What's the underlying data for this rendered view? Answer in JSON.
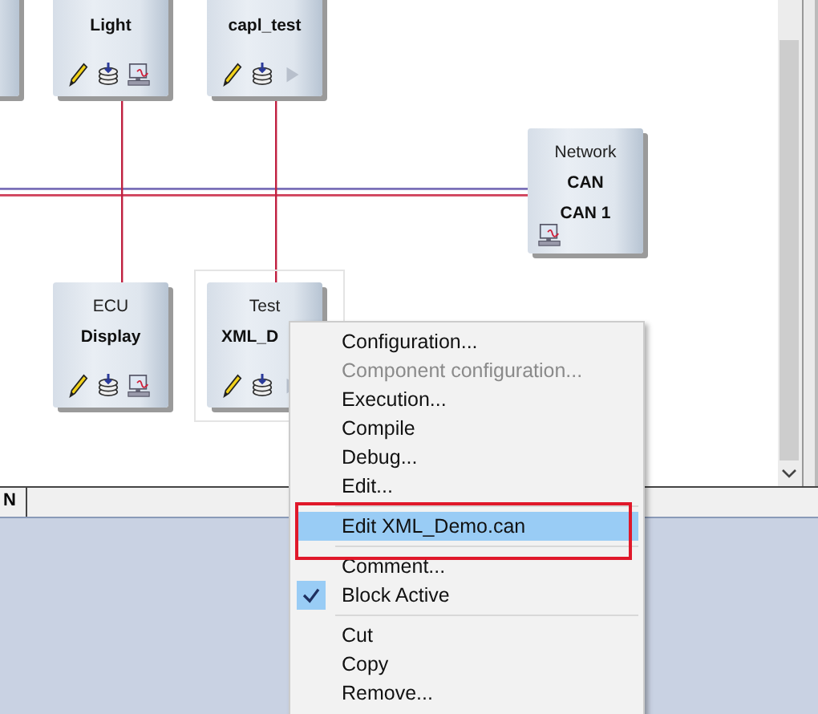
{
  "nodes": [
    {
      "kind": "stub"
    },
    {
      "kind": "ecu",
      "names": [
        "Light"
      ]
    },
    {
      "kind": "test",
      "names": [
        "capl_test"
      ]
    },
    {
      "kind": "network",
      "type": "Network",
      "names": [
        "CAN",
        "CAN 1"
      ]
    },
    {
      "kind": "ecu",
      "type": "ECU",
      "names": [
        "Display"
      ]
    },
    {
      "kind": "test",
      "type": "Test",
      "names": [
        "XML_D"
      ],
      "selected": true
    }
  ],
  "tab": {
    "label": "N"
  },
  "context_menu": [
    {
      "kind": "item",
      "label": "Configuration...",
      "disabled": false,
      "checked": false,
      "selected": false
    },
    {
      "kind": "item",
      "label": "Component configuration...",
      "disabled": true,
      "checked": false,
      "selected": false
    },
    {
      "kind": "item",
      "label": "Execution...",
      "disabled": false,
      "checked": false,
      "selected": false
    },
    {
      "kind": "item",
      "label": "Compile",
      "disabled": false,
      "checked": false,
      "selected": false
    },
    {
      "kind": "item",
      "label": "Debug...",
      "disabled": false,
      "checked": false,
      "selected": false
    },
    {
      "kind": "item",
      "label": "Edit...",
      "disabled": false,
      "checked": false,
      "selected": false
    },
    {
      "kind": "separator"
    },
    {
      "kind": "item",
      "label": "Edit XML_Demo.can",
      "disabled": false,
      "checked": false,
      "selected": true
    },
    {
      "kind": "separator"
    },
    {
      "kind": "item",
      "label": "Comment...",
      "disabled": false,
      "checked": false,
      "selected": false
    },
    {
      "kind": "item",
      "label": "Block Active",
      "disabled": false,
      "checked": true,
      "selected": false
    },
    {
      "kind": "separator"
    },
    {
      "kind": "item",
      "label": "Cut",
      "disabled": false,
      "checked": false,
      "selected": false
    },
    {
      "kind": "item",
      "label": "Copy",
      "disabled": false,
      "checked": false,
      "selected": false
    },
    {
      "kind": "item",
      "label": "Remove...",
      "disabled": false,
      "checked": false,
      "selected": false
    }
  ]
}
